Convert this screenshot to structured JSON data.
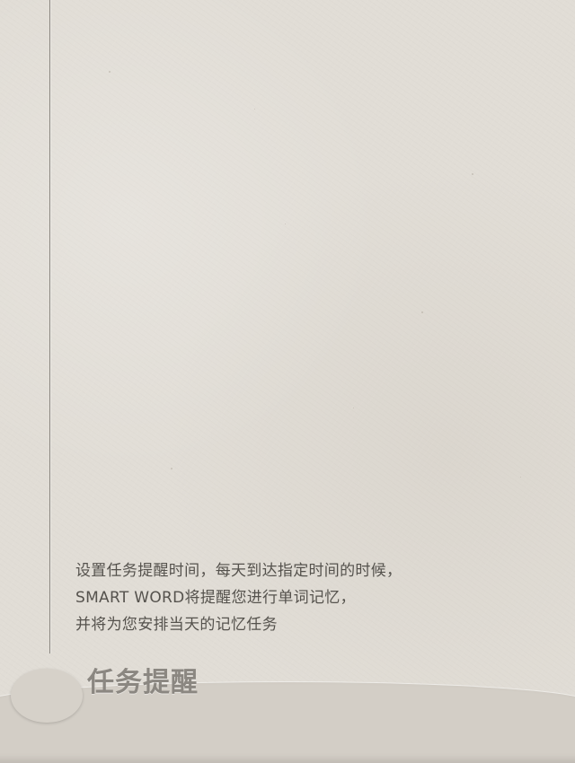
{
  "page": {
    "description_lines": [
      "设置任务提醒时间，每天到达指定时间的时候，",
      "SMART WORD将提醒您进行单词记忆，",
      "并将为您安排当天的记忆任务"
    ],
    "section_title": "任务提醒"
  },
  "colors": {
    "paper": "#e1ddd6",
    "text": "#55524d",
    "title": "#8b8781",
    "margin_line": "#8b8780"
  }
}
